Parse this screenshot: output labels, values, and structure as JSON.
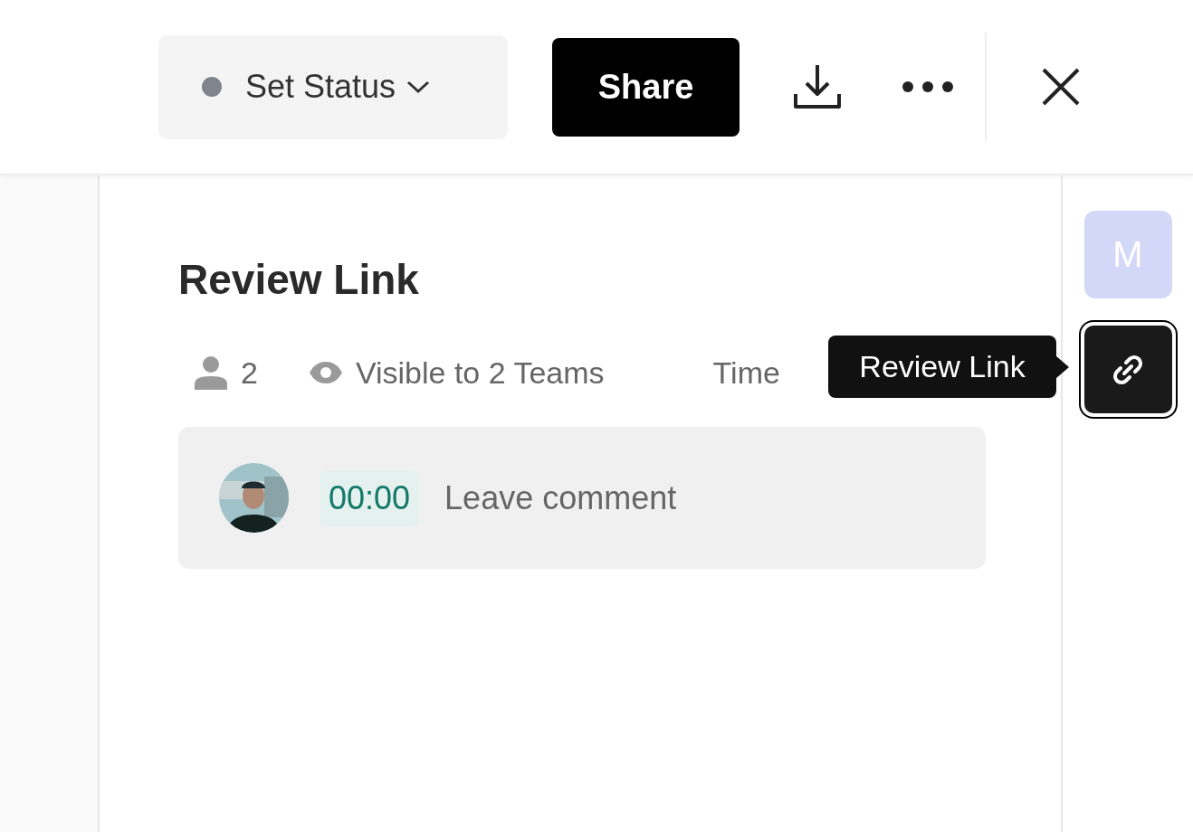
{
  "header": {
    "status_button": {
      "label": "Set Status",
      "color": "#80858d"
    },
    "share_button": {
      "label": "Share"
    }
  },
  "review": {
    "title": "Review Link",
    "participants": "2",
    "visibility": "Visible to 2 Teams",
    "sort_label": "Time"
  },
  "comment": {
    "timecode": "00:00",
    "placeholder": "Leave comment"
  },
  "rail": {
    "user_initial": "M",
    "link_button": {
      "selected": true
    }
  },
  "tooltip": {
    "text": "Review Link"
  }
}
